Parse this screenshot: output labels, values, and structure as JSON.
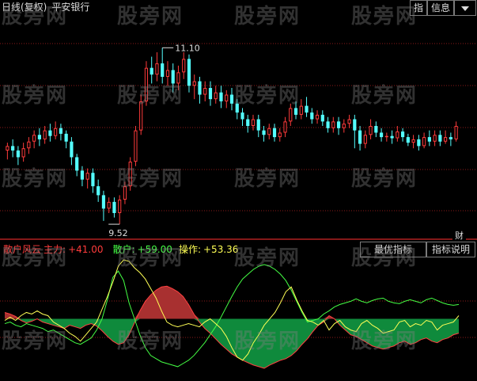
{
  "header": {
    "mode_label": "日线(复权)",
    "stock_name": "平安银行",
    "btn_indicator": "指",
    "btn_info": "信息",
    "btn_fin": "财"
  },
  "indicator": {
    "name": "散户风云",
    "main_label": "主力:",
    "main_value": "+41.00",
    "retail_label": "散户:",
    "retail_value": "+59.00",
    "op_label": "操作:",
    "op_value": "+53.36",
    "btn_best": "最优指标",
    "btn_explain": "指标说明"
  },
  "watermark_text": "股旁网",
  "colors": {
    "up": "#ff3b3b",
    "down": "#54ffff",
    "grid": "#8b1a1a",
    "main": "#ff4040",
    "retail": "#44ff44",
    "op": "#ffff55",
    "area_pos": "#a83030",
    "area_neg": "#0f8a3c"
  },
  "chart_data": {
    "type": "candlestick",
    "price_annotations": [
      {
        "label": "11.10",
        "value": 11.1
      },
      {
        "label": "9.52",
        "value": 9.52
      }
    ],
    "candles": [
      [
        10.18,
        10.22,
        10.25,
        10.1
      ],
      [
        10.22,
        10.18,
        10.28,
        10.12
      ],
      [
        10.18,
        10.12,
        10.22,
        10.05
      ],
      [
        10.12,
        10.2,
        10.25,
        10.08
      ],
      [
        10.2,
        10.26,
        10.3,
        10.15
      ],
      [
        10.26,
        10.32,
        10.36,
        10.2
      ],
      [
        10.32,
        10.28,
        10.38,
        10.22
      ],
      [
        10.28,
        10.36,
        10.4,
        10.24
      ],
      [
        10.36,
        10.31,
        10.42,
        10.26
      ],
      [
        10.31,
        10.38,
        10.44,
        10.28
      ],
      [
        10.38,
        10.33,
        10.42,
        10.27
      ],
      [
        10.33,
        10.26,
        10.36,
        10.2
      ],
      [
        10.26,
        10.12,
        10.3,
        10.05
      ],
      [
        10.12,
        10.0,
        10.15,
        9.95
      ],
      [
        10.0,
        9.92,
        10.04,
        9.86
      ],
      [
        9.92,
        9.98,
        10.02,
        9.84
      ],
      [
        9.98,
        9.86,
        10.02,
        9.8
      ],
      [
        9.86,
        9.78,
        9.92,
        9.72
      ],
      [
        9.78,
        9.66,
        9.82,
        9.55
      ],
      [
        9.66,
        9.72,
        9.76,
        9.62
      ],
      [
        9.72,
        9.62,
        9.76,
        9.58
      ],
      [
        9.62,
        9.74,
        9.78,
        9.52
      ],
      [
        9.74,
        9.86,
        9.9,
        9.7
      ],
      [
        9.86,
        10.08,
        10.12,
        9.82
      ],
      [
        10.08,
        10.36,
        10.4,
        10.04
      ],
      [
        10.36,
        10.62,
        10.68,
        10.32
      ],
      [
        10.62,
        10.92,
        10.98,
        10.58
      ],
      [
        10.92,
        10.86,
        11.02,
        10.78
      ],
      [
        10.86,
        10.96,
        11.06,
        10.8
      ],
      [
        10.96,
        10.84,
        11.1,
        10.78
      ],
      [
        10.84,
        10.9,
        10.98,
        10.76
      ],
      [
        10.9,
        10.78,
        10.96,
        10.7
      ],
      [
        10.78,
        10.88,
        10.94,
        10.72
      ],
      [
        10.88,
        11.0,
        11.06,
        10.82
      ],
      [
        11.0,
        10.76,
        11.04,
        10.7
      ],
      [
        10.76,
        10.8,
        10.86,
        10.64
      ],
      [
        10.8,
        10.68,
        10.84,
        10.6
      ],
      [
        10.68,
        10.74,
        10.8,
        10.62
      ],
      [
        10.74,
        10.64,
        10.8,
        10.58
      ],
      [
        10.64,
        10.7,
        10.76,
        10.6
      ],
      [
        10.7,
        10.62,
        10.76,
        10.56
      ],
      [
        10.62,
        10.68,
        10.72,
        10.56
      ],
      [
        10.68,
        10.6,
        10.74,
        10.54
      ],
      [
        10.6,
        10.52,
        10.64,
        10.46
      ],
      [
        10.52,
        10.46,
        10.56,
        10.4
      ],
      [
        10.46,
        10.4,
        10.5,
        10.34
      ],
      [
        10.4,
        10.46,
        10.5,
        10.36
      ],
      [
        10.46,
        10.36,
        10.5,
        10.3
      ],
      [
        10.36,
        10.32,
        10.4,
        10.26
      ],
      [
        10.32,
        10.38,
        10.42,
        10.28
      ],
      [
        10.38,
        10.3,
        10.42,
        10.26
      ],
      [
        10.3,
        10.34,
        10.38,
        10.26
      ],
      [
        10.34,
        10.44,
        10.48,
        10.3
      ],
      [
        10.44,
        10.56,
        10.6,
        10.4
      ],
      [
        10.56,
        10.5,
        10.62,
        10.46
      ],
      [
        10.5,
        10.58,
        10.64,
        10.46
      ],
      [
        10.58,
        10.52,
        10.66,
        10.48
      ],
      [
        10.52,
        10.46,
        10.56,
        10.42
      ],
      [
        10.46,
        10.5,
        10.54,
        10.42
      ],
      [
        10.5,
        10.44,
        10.54,
        10.4
      ],
      [
        10.44,
        10.38,
        10.48,
        10.34
      ],
      [
        10.38,
        10.44,
        10.48,
        10.34
      ],
      [
        10.44,
        10.38,
        10.48,
        10.32
      ],
      [
        10.38,
        10.42,
        10.46,
        10.34
      ],
      [
        10.42,
        10.46,
        10.5,
        10.38
      ],
      [
        10.46,
        10.36,
        10.5,
        10.2
      ],
      [
        10.36,
        10.24,
        10.4,
        10.18
      ],
      [
        10.24,
        10.32,
        10.36,
        10.2
      ],
      [
        10.32,
        10.4,
        10.46,
        10.28
      ],
      [
        10.4,
        10.34,
        10.44,
        10.3
      ],
      [
        10.34,
        10.3,
        10.38,
        10.26
      ],
      [
        10.3,
        10.31,
        10.34,
        10.26
      ],
      [
        10.31,
        10.29,
        10.36,
        10.24
      ],
      [
        10.29,
        10.35,
        10.4,
        10.26
      ],
      [
        10.35,
        10.3,
        10.38,
        10.26
      ],
      [
        10.3,
        10.25,
        10.33,
        10.22
      ],
      [
        10.25,
        10.28,
        10.32,
        10.2
      ],
      [
        10.28,
        10.22,
        10.32,
        10.18
      ],
      [
        10.22,
        10.3,
        10.34,
        10.2
      ],
      [
        10.3,
        10.26,
        10.36,
        10.22
      ],
      [
        10.26,
        10.32,
        10.36,
        10.22
      ],
      [
        10.32,
        10.26,
        10.36,
        10.22
      ],
      [
        10.26,
        10.3,
        10.36,
        10.24
      ],
      [
        10.3,
        10.28,
        10.34,
        10.22
      ],
      [
        10.28,
        10.4,
        10.44,
        10.26
      ]
    ],
    "series": [
      {
        "name": "主力",
        "values": [
          8,
          6,
          3,
          -2,
          -5,
          -3,
          0,
          -4,
          -6,
          -8,
          -10,
          -12,
          -8,
          -10,
          -12,
          -8,
          -6,
          -9,
          -15,
          -22,
          -28,
          -32,
          -30,
          -20,
          -5,
          10,
          22,
          30,
          36,
          40,
          41,
          38,
          34,
          28,
          18,
          6,
          -4,
          -12,
          -18,
          -25,
          -32,
          -38,
          -44,
          -48,
          -52,
          -55,
          -58,
          -60,
          -62,
          -58,
          -55,
          -52,
          -50,
          -46,
          -40,
          -32,
          -25,
          -16,
          -8,
          -4,
          4,
          0,
          -8,
          -14,
          -20,
          -22,
          -26,
          -30,
          -34,
          -36,
          -38,
          -36,
          -34,
          -30,
          -28,
          -32,
          -30,
          -26,
          -24,
          -28,
          -30,
          -26,
          -24,
          -20,
          -18
        ]
      },
      {
        "name": "散户",
        "values": [
          -6,
          -4,
          -8,
          -10,
          -6,
          -8,
          -10,
          -12,
          -16,
          -14,
          -18,
          -22,
          -26,
          -30,
          -32,
          -28,
          -24,
          -14,
          0,
          24,
          52,
          60,
          48,
          20,
          0,
          -20,
          -36,
          -46,
          -50,
          -54,
          -56,
          -58,
          -60,
          -56,
          -52,
          -46,
          -38,
          -30,
          -20,
          -10,
          2,
          15,
          28,
          40,
          50,
          56,
          62,
          66,
          68,
          66,
          62,
          56,
          48,
          36,
          22,
          8,
          -4,
          -2,
          0,
          6,
          10,
          15,
          18,
          20,
          22,
          25,
          22,
          20,
          23,
          25,
          26,
          22,
          20,
          19,
          22,
          24,
          22,
          20,
          24,
          26,
          23,
          20,
          18,
          17,
          18
        ]
      },
      {
        "name": "操作",
        "values": [
          -2,
          2,
          -2,
          4,
          8,
          6,
          10,
          6,
          4,
          -4,
          -8,
          -12,
          -18,
          -22,
          -28,
          -20,
          -12,
          -4,
          12,
          28,
          46,
          66,
          74,
          72,
          64,
          58,
          50,
          38,
          26,
          10,
          -4,
          -8,
          -10,
          -8,
          -6,
          -8,
          -10,
          -4,
          0,
          -6,
          -12,
          -22,
          -36,
          -48,
          -52,
          -44,
          -30,
          -20,
          -8,
          0,
          8,
          20,
          34,
          40,
          24,
          10,
          -2,
          -4,
          -8,
          -2,
          -14,
          -6,
          -2,
          -10,
          -14,
          -16,
          -6,
          -2,
          -8,
          -12,
          -18,
          -16,
          -14,
          -4,
          -2,
          -10,
          -6,
          -8,
          -2,
          -4,
          -14,
          -8,
          -6,
          -4,
          4
        ]
      }
    ],
    "main_ylim": [
      9.4,
      11.4
    ],
    "indicator_ylim": [
      -75,
      80
    ]
  }
}
